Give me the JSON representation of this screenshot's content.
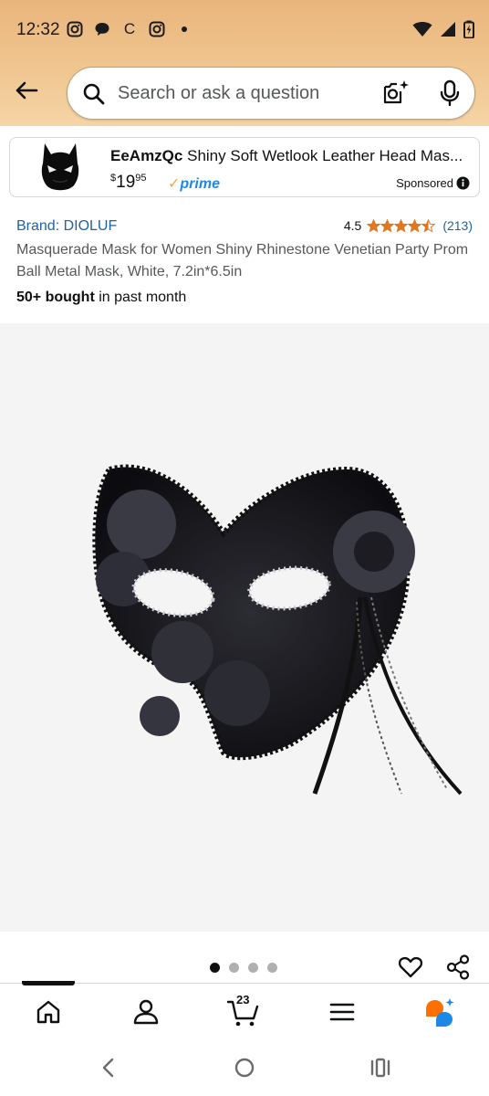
{
  "status_bar": {
    "time": "12:32",
    "left_icons": [
      "instagram-icon",
      "chat-bubble-icon",
      "c-letter-icon",
      "instagram-icon",
      "dot-icon"
    ],
    "c_letter": "C",
    "right_icons": [
      "wifi-icon",
      "signal-icon",
      "battery-icon"
    ]
  },
  "header": {
    "search_placeholder": "Search or ask a question"
  },
  "ad": {
    "brand": "EeAmzQc",
    "title": "Shiny Soft Wetlook Leather Head Mas...",
    "price_dollar": "$",
    "price_whole": "19",
    "price_fraction": "95",
    "prime_label": "prime",
    "sponsored_label": "Sponsored"
  },
  "product": {
    "brand_label": "Brand: DIOLUF",
    "rating": "4.5",
    "rating_value": 4.5,
    "rating_count": "(213)",
    "title": "Masquerade Mask for Women Shiny Rhinestone Venetian Party Prom Ball Metal Mask, White, 7.2in*6.5in",
    "bought_bold": "50+ bought",
    "bought_rest": " in past month"
  },
  "gallery": {
    "total_images": 4,
    "active_index": 0
  },
  "bottom_nav": {
    "items": [
      "home-icon",
      "account-icon",
      "cart-icon",
      "menu-icon",
      "rufus-icon"
    ],
    "cart_count": "23"
  },
  "colors": {
    "header_top": "#e9b57c",
    "header_bottom": "#f5d4a6",
    "link_blue": "#2162a1",
    "star_orange": "#de7921",
    "prime_blue": "#1e88e5",
    "rufus_orange": "#ff6f00"
  }
}
